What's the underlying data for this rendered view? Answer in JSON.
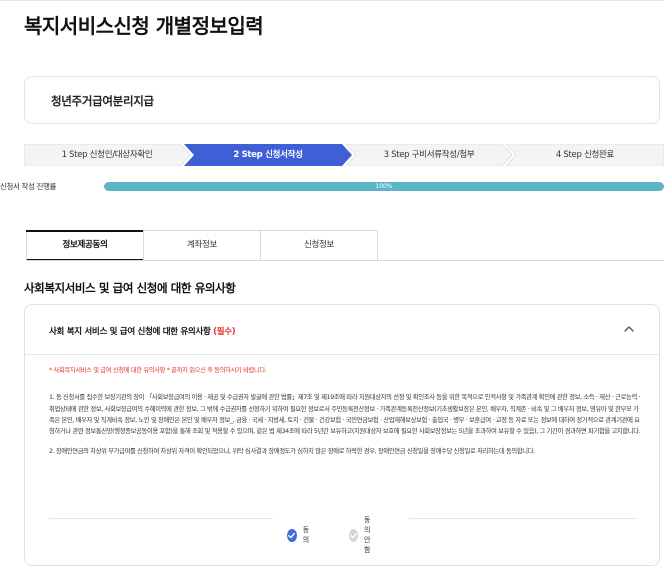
{
  "page": {
    "title": "복지서비스신청 개별정보입력",
    "service_name": "청년주거급여분리지급"
  },
  "steps": [
    {
      "label": "1 Step 신청인/대상자확인",
      "active": false
    },
    {
      "label": "2 Step 신청서작성",
      "active": true
    },
    {
      "label": "3 Step 구비서류작성/첨부",
      "active": false
    },
    {
      "label": "4 Step 신청완료",
      "active": false
    }
  ],
  "progress": {
    "label": "신청서 작성 진행률",
    "value_text": "100%",
    "value": 100
  },
  "tabs": [
    {
      "label": "정보제공동의",
      "active": true
    },
    {
      "label": "계좌정보",
      "active": false
    },
    {
      "label": "신청정보",
      "active": false
    }
  ],
  "section": {
    "title": "사회복지서비스 및 급여 신청에 대한 유의사항"
  },
  "notice": {
    "title": "사회 복지 서비스 및 급여 신청에 대한 유의사항",
    "required": "(필수)",
    "warning": "* 사회복지서비스 및 급여 신청에 대한 유의사항 * 끝까지 읽으신 후 동의하시기 바랍니다.",
    "para1": "1. 동 신청서를 접수한 보장기관의 장이 「사회보장급여의 이용 · 제공 및 수급권자 발굴에 관한 법률」제7조 및 제19조에 따라 지원대상자의 선정 및 확인조사 등을 위한 목적으로 인적사항 및 가족관계 확인에 관한 정보, 소득 · 재산 · 근로능력 · 취업상태에 관한 정보, 사회보장급여의 수혜이력에 관한 정보, 그 밖에 수급권자를 선정하기 위하여 필요한 정보로서 주민등록전산정보 · 가족관계등록전산정보(기초생활보장은 본인, 배우자, 직계존 · 비속 및 그 배우자 정보, 영유아 및 한부모 가족은 본인, 배우자 및 직계비속 정보, 노인 및 장애인은 본인 및 배우자 정보_, 금융 · 국세 · 지방세, 토지 · 건물 · 건강보험 · 국민연금보험 · 산업재해보상보험 · 출입국 · 병무 · 보훈급여 · 교정 등 자료 또는 정보에 대하여 정기적으로 관계기관에 요청하거나 관련 정보통신망(행정종보공동이용 포함)을 통해 조회 및 적용할 수 있으며, 같은 법 제34조에 따라 5년간 보유하고(지원대상자 보호에 필요한 사회보장정보는 5년을 초과하여 보유할 수 있음), 그 기간이 경과하면 파기함을 고지합니다.",
    "para2": "2. 장애인연금의 차상위 부가급여를 신청하여 차상위 자격이 확인되었으나, 위탁 심사결과 장애정도가 심하지 않은 장애로 하락한 경우, 장애인연금 신청일을 장애수당 신청일로 처리하는데 동의합니다."
  },
  "consent": {
    "agree_label": "동의",
    "disagree_label": "동의 안함",
    "selected": "agree"
  },
  "colors": {
    "step_active": "#3e5fd6",
    "step_inactive": "#f4f4f4",
    "progress_fill": "#5bb5c9",
    "required_red": "#e0352b",
    "radio_on": "#3e6fd8"
  }
}
